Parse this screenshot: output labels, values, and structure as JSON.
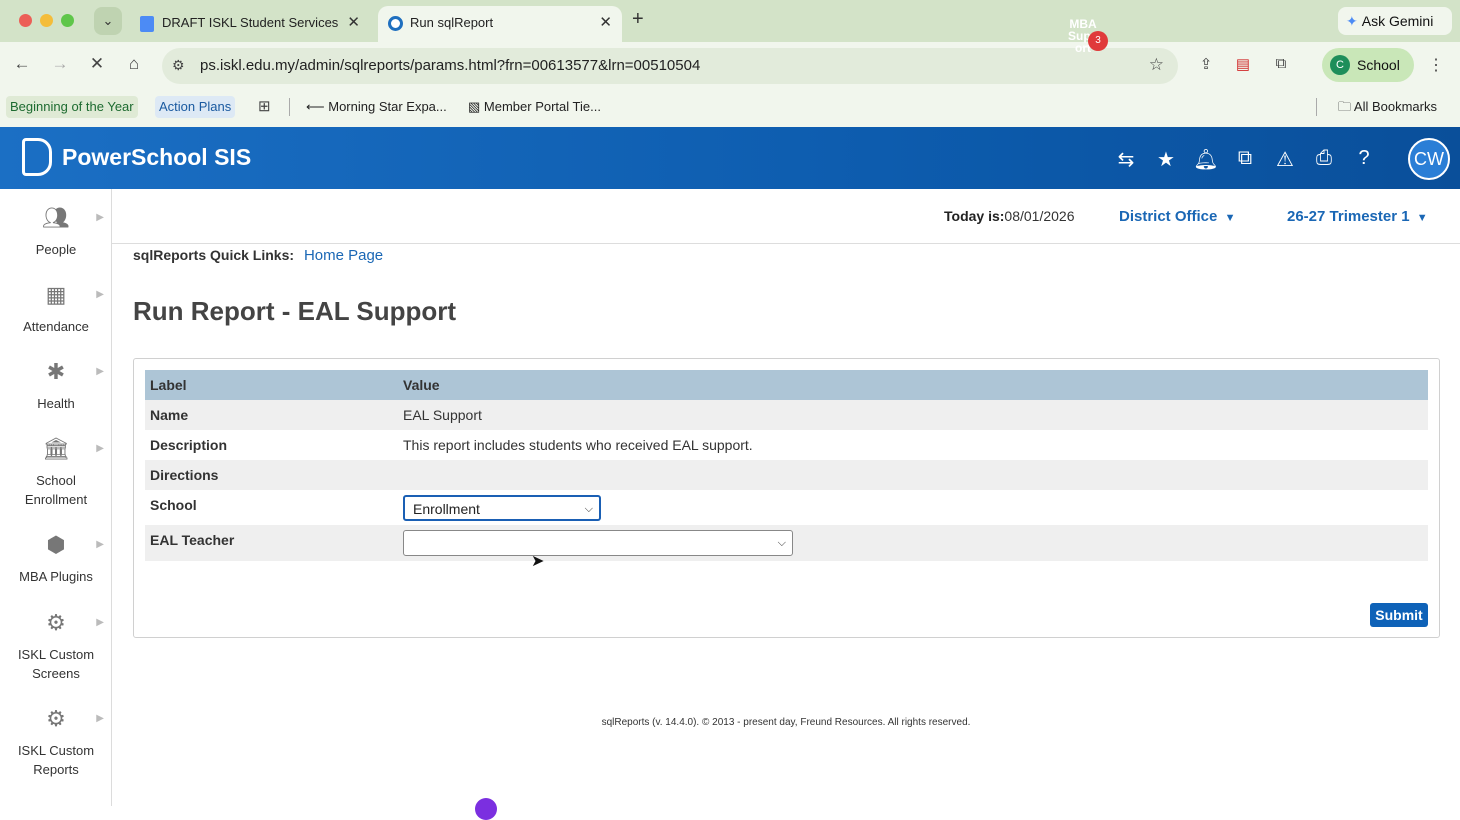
{
  "browser": {
    "tabs": [
      {
        "title": "DRAFT ISKL Student Services"
      },
      {
        "title": "Run sqlReport"
      }
    ],
    "ask_gemini": "Ask Gemini",
    "url": "ps.iskl.edu.my/admin/sqlreports/params.html?frn=00613577&lrn=00510504",
    "profile_initial": "C",
    "profile_name": "School",
    "bookmarks": [
      {
        "label": "Beginning of the Year"
      },
      {
        "label": "Action Plans"
      },
      {
        "label": "Morning Star Expa..."
      },
      {
        "label": "Member Portal Tie..."
      }
    ],
    "all_bookmarks": "All Bookmarks"
  },
  "header": {
    "app_title": "PowerSchool SIS",
    "mba_label": "MBA Support",
    "mba_badge": "3",
    "avatar": "CW"
  },
  "sidebar": {
    "items": [
      {
        "label": "People",
        "icon": "people-icon"
      },
      {
        "label": "Attendance",
        "icon": "attendance-icon"
      },
      {
        "label": "Health",
        "icon": "health-icon"
      },
      {
        "label": "School Enrollment",
        "icon": "school-icon"
      },
      {
        "label": "MBA Plugins",
        "icon": "cube-icon"
      },
      {
        "label": "ISKL Custom Screens",
        "icon": "custom-screens-icon"
      },
      {
        "label": "ISKL Custom Reports",
        "icon": "custom-reports-icon"
      }
    ]
  },
  "topline": {
    "today_label": "Today is:",
    "today_value": "08/01/2026",
    "school_selector": "District Office",
    "term_selector": "26-27 Trimester 1"
  },
  "quick_links": {
    "label": "sqlReports Quick Links:",
    "home": "Home Page"
  },
  "page_title": "Run Report - EAL Support",
  "table": {
    "headers": {
      "label": "Label",
      "value": "Value"
    },
    "rows": {
      "name": {
        "label": "Name",
        "value": "EAL Support"
      },
      "description": {
        "label": "Description",
        "value": "This report includes students who received EAL support."
      },
      "directions": {
        "label": "Directions",
        "value": ""
      },
      "school": {
        "label": "School",
        "value": "Enrollment"
      },
      "eal_teacher": {
        "label": "EAL Teacher",
        "value": ""
      }
    }
  },
  "submit_label": "Submit",
  "footer": "sqlReports (v. 14.4.0). © 2013 - present day, Freund Resources. All rights reserved."
}
